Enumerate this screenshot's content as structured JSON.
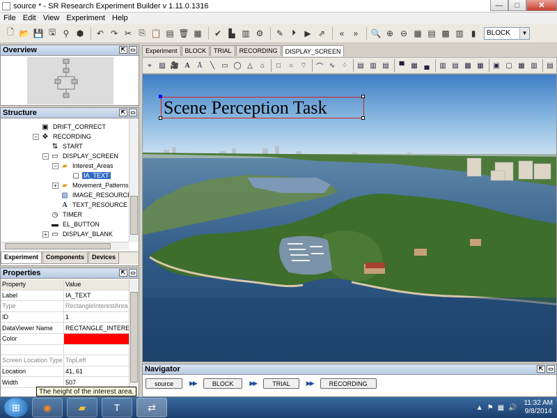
{
  "window": {
    "title": "source * - SR Research Experiment Builder v 1.11.0.1316",
    "minimize": "—",
    "maximize": "□",
    "close": "✕"
  },
  "menu": [
    "File",
    "Edit",
    "View",
    "Experiment",
    "Help"
  ],
  "toolbar": {
    "block_select": "BLOCK"
  },
  "overview": {
    "title": "Overview"
  },
  "structure": {
    "title": "Structure",
    "tree": [
      {
        "label": "DRIFT_CORRECT",
        "icon": "drift-correct-icon",
        "glyph": "▣"
      },
      {
        "label": "RECORDING",
        "icon": "recording-icon",
        "glyph": "✥",
        "expander": "−"
      },
      {
        "label": "START",
        "icon": "start-icon",
        "glyph": "⇅"
      },
      {
        "label": "DISPLAY_SCREEN",
        "icon": "display-screen-icon",
        "glyph": "▭",
        "expander": "−"
      },
      {
        "label": "Interest_Areas",
        "icon": "folder-icon",
        "glyph": "▰",
        "expander": "−"
      },
      {
        "label": "IA_TEXT",
        "icon": "rectangle-icon",
        "glyph": "▢"
      },
      {
        "label": "Movement_Patterns",
        "icon": "folder-icon",
        "glyph": "▰",
        "expander": "+"
      },
      {
        "label": "IMAGE_RESOURCE",
        "icon": "image-resource-icon",
        "glyph": "▨"
      },
      {
        "label": "TEXT_RESOURCE",
        "icon": "text-resource-icon",
        "glyph": "A"
      },
      {
        "label": "TIMER",
        "icon": "timer-icon",
        "glyph": "◷"
      },
      {
        "label": "EL_BUTTON",
        "icon": "button-icon",
        "glyph": "▬"
      },
      {
        "label": "DISPLAY_BLANK",
        "icon": "display-blank-icon",
        "glyph": "▭",
        "expander": "+"
      }
    ],
    "tabs": [
      "Experiment",
      "Components",
      "Devices"
    ]
  },
  "properties": {
    "title": "Properties",
    "header": {
      "property": "Property",
      "value": "Value"
    },
    "rows": [
      {
        "k": "Label",
        "v": "IA_TEXT"
      },
      {
        "k": "Type",
        "v": "RectangleInterestArea"
      },
      {
        "k": "ID",
        "v": "1"
      },
      {
        "k": "DataViewer Name",
        "v": "RECTANGLE_INTERE..."
      },
      {
        "k": "Color",
        "v": ""
      },
      {
        "k": "",
        "v": ""
      },
      {
        "k": "Screen Location Type",
        "v": "TopLeft"
      },
      {
        "k": "Location",
        "v": "41, 61"
      },
      {
        "k": "Width",
        "v": "507"
      }
    ],
    "tooltip": "The height of the interest area."
  },
  "editor_tabs": [
    "Experiment",
    "BLOCK",
    "TRIAL",
    "RECORDING",
    "DISPLAY_SCREEN"
  ],
  "canvas": {
    "text": "Scene Perception Task"
  },
  "navigator": {
    "title": "Navigator",
    "crumbs": [
      "source",
      "BLOCK",
      "TRIAL",
      "RECORDING"
    ]
  },
  "taskbar": {
    "time": "11:32 AM",
    "date": "9/8/2014"
  },
  "colors": {
    "selection": "#316ac5",
    "ia_color": "#ff0000",
    "ia_border": "#d02020"
  }
}
